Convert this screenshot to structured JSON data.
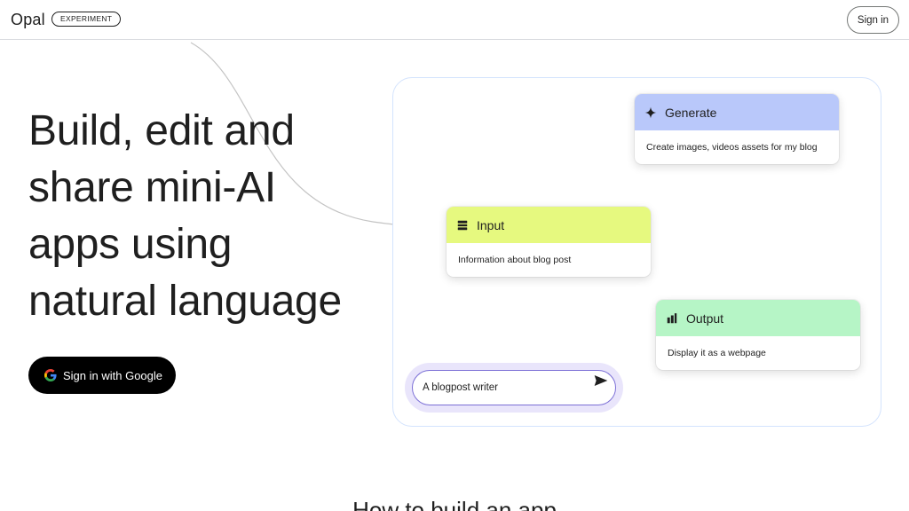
{
  "header": {
    "logo": "Opal",
    "badge": "EXPERIMENT",
    "signin_label": "Sign in"
  },
  "hero": {
    "lines": [
      "Build, edit and",
      "share mini-AI",
      "apps using",
      "natural language"
    ],
    "google_button_label": "Sign in with Google"
  },
  "diagram": {
    "nodes": [
      {
        "title": "Generate",
        "description": "Create images, videos assets for my blog",
        "icon": "sparkle-icon",
        "color": "#b9c8fa"
      },
      {
        "title": "Input",
        "description": "Information about blog post",
        "icon": "input-icon",
        "color": "#e6f97f"
      },
      {
        "title": "Output",
        "description": "Display it as a webpage",
        "icon": "output-icon",
        "color": "#b6f5c6"
      }
    ],
    "prompt": {
      "value": "A blogpost writer"
    }
  },
  "bottom_heading": "How to build an app"
}
